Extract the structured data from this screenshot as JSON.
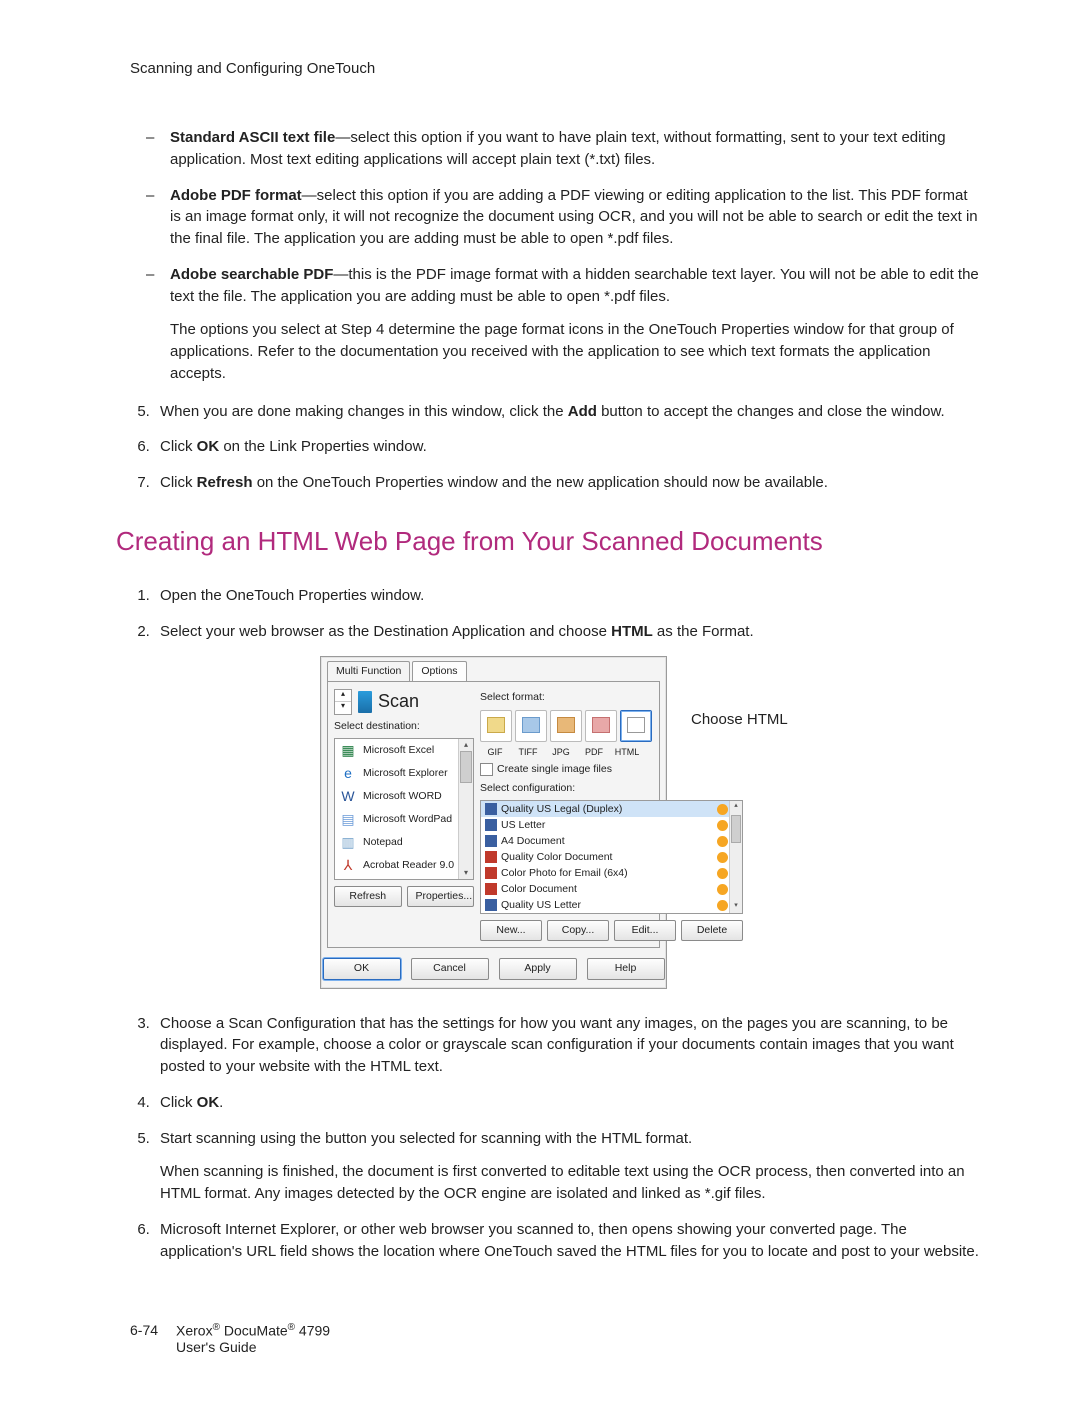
{
  "header": "Scanning and Configuring OneTouch",
  "bullets": {
    "ascii": {
      "lead": "Standard ASCII text file",
      "text": "—select this option if you want to have plain text, without formatting, sent to your text editing application. Most text editing applications will accept plain text (*.txt) files."
    },
    "pdf": {
      "lead": "Adobe PDF format",
      "text": "—select this option if you are adding a PDF viewing or editing application to the list. This PDF format is an image format only, it will not recognize the document using OCR, and you will not be able to search or edit the text in the final file. The application you are adding must be able to open *.pdf files."
    },
    "spdf": {
      "lead": "Adobe searchable PDF",
      "text": "—this is the PDF image format with a hidden searchable text layer. You will not be able to edit the text the file. The application you are adding must be able to open *.pdf files."
    },
    "spdf_extra": "The options you select at Step 4 determine the page format icons in the OneTouch Properties window for that group of applications. Refer to the documentation you received with the application to see which text formats the application accepts."
  },
  "steps_a": {
    "s5a": "When you are done making changes in this window, click the ",
    "s5b": "Add",
    "s5c": " button to accept the changes and close the window.",
    "s6a": "Click ",
    "s6b": "OK",
    "s6c": " on the Link Properties window.",
    "s7a": "Click ",
    "s7b": "Refresh",
    "s7c": " on the OneTouch Properties window and the new application should now be available."
  },
  "section_title": "Creating an HTML Web Page from Your Scanned Documents",
  "steps_b": {
    "s1": "Open the OneTouch Properties window.",
    "s2a": "Select your web browser as the Destination Application and choose ",
    "s2b": "HTML",
    "s2c": " as the Format.",
    "s3": "Choose a Scan Configuration that has the settings for how you want any images, on the pages you are scanning, to be displayed. For example, choose a color or grayscale scan configuration if your documents contain images that you want posted to your website with the HTML text.",
    "s4a": "Click ",
    "s4b": "OK",
    "s4c": ".",
    "s5": "Start scanning using the button you selected for scanning with the HTML format.",
    "s5_extra": "When scanning is finished, the document is first converted to editable text using the OCR process, then converted into an HTML format. Any images detected by the OCR engine are isolated and linked as *.gif files.",
    "s6": "Microsoft Internet Explorer, or other web browser you scanned to, then opens showing your converted page. The application's URL field shows the location where OneTouch saved the HTML files for you to locate and post to your website."
  },
  "dialog": {
    "tabs": {
      "t1": "Multi Function",
      "t2": "Options"
    },
    "scan_title": "Scan",
    "lbl_dest": "Select destination:",
    "lbl_format": "Select format:",
    "lbl_config": "Select configuration:",
    "checkbox": "Create single image files",
    "dest": [
      "Microsoft Excel",
      "Microsoft Explorer",
      "Microsoft WORD",
      "Microsoft WordPad",
      "Notepad",
      "Acrobat Reader 9.0"
    ],
    "fmt": [
      "GIF",
      "TIFF",
      "JPG",
      "PDF",
      "HTML"
    ],
    "cfg": [
      "Quality US Legal (Duplex)",
      "US Letter",
      "A4 Document",
      "Quality Color Document",
      "Color Photo for Email (6x4)",
      "Color Document",
      "Quality US Letter"
    ],
    "btns_left": {
      "refresh": "Refresh",
      "props": "Properties..."
    },
    "btns_right": {
      "new": "New...",
      "copy": "Copy...",
      "edit": "Edit...",
      "del": "Delete"
    },
    "bottom": {
      "ok": "OK",
      "cancel": "Cancel",
      "apply": "Apply",
      "help": "Help"
    }
  },
  "callout": "Choose HTML",
  "footer": {
    "page": "6-74",
    "line1a": "Xerox",
    "line1b": " DocuMate",
    "line1c": " 4799",
    "line2": "User's Guide",
    "reg": "®"
  }
}
